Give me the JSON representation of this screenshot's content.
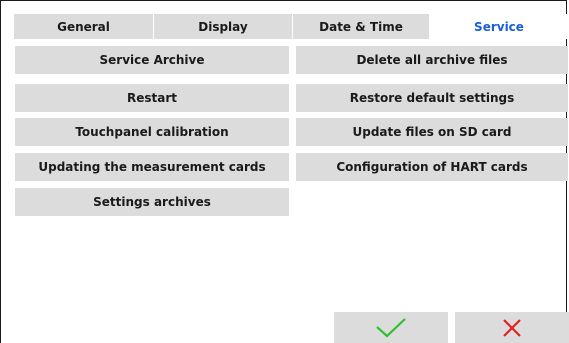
{
  "tabs": [
    {
      "label": "General",
      "active": false
    },
    {
      "label": "Display",
      "active": false
    },
    {
      "label": "Date & Time",
      "active": false
    },
    {
      "label": "Service",
      "active": true
    }
  ],
  "buttons": {
    "service_archive": "Service Archive",
    "delete_archive": "Delete all archive files",
    "restart": "Restart",
    "restore_defaults": "Restore default settings",
    "touchpanel_calibration": "Touchpanel calibration",
    "update_sd": "Update files on SD card",
    "updating_measurement_cards": "Updating the measurement cards",
    "hart_config": "Configuration of HART cards",
    "settings_archives": "Settings archives"
  },
  "actions": {
    "confirm_icon": "check-icon",
    "cancel_icon": "close-icon"
  },
  "colors": {
    "active_tab_text": "#1a5fd6",
    "button_bg": "#dcdcdc",
    "confirm": "#2fbf2f",
    "cancel": "#e02020"
  }
}
